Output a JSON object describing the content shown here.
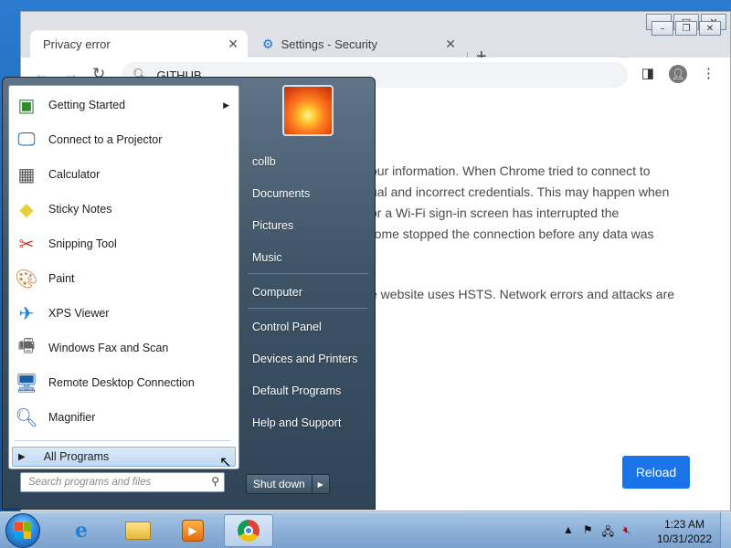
{
  "browser": {
    "tabs": [
      {
        "label": "Privacy error",
        "active": true
      },
      {
        "label": "Settings - Security",
        "active": false
      }
    ],
    "address": "GITHUB",
    "content_lines": [
      "our information. When Chrome tried to connect to",
      "ual and incorrect credentials. This may happen when",
      " or a Wi-Fi sign-in screen has interrupted the",
      "rome stopped the connection before any data was",
      "e website uses HSTS. Network errors and attacks are"
    ],
    "reload_label": "Reload"
  },
  "start_menu": {
    "programs": [
      {
        "label": "Getting Started",
        "icon": "getting-started-icon",
        "has_submenu": true
      },
      {
        "label": "Connect to a Projector",
        "icon": "projector-icon"
      },
      {
        "label": "Calculator",
        "icon": "calculator-icon"
      },
      {
        "label": "Sticky Notes",
        "icon": "sticky-notes-icon"
      },
      {
        "label": "Snipping Tool",
        "icon": "scissors-icon"
      },
      {
        "label": "Paint",
        "icon": "paint-palette-icon"
      },
      {
        "label": "XPS Viewer",
        "icon": "xps-viewer-icon"
      },
      {
        "label": "Windows Fax and Scan",
        "icon": "fax-icon"
      },
      {
        "label": "Remote Desktop Connection",
        "icon": "remote-desktop-icon"
      },
      {
        "label": "Magnifier",
        "icon": "magnifier-icon"
      }
    ],
    "all_programs": "All Programs",
    "search_placeholder": "Search programs and files",
    "right_links": {
      "user": "collb",
      "documents": "Documents",
      "pictures": "Pictures",
      "music": "Music",
      "computer": "Computer",
      "control_panel": "Control Panel",
      "devices": "Devices and Printers",
      "default_programs": "Default Programs",
      "help": "Help and Support"
    },
    "shutdown": "Shut down"
  },
  "taskbar": {
    "time": "1:23 AM",
    "date": "10/31/2022"
  }
}
